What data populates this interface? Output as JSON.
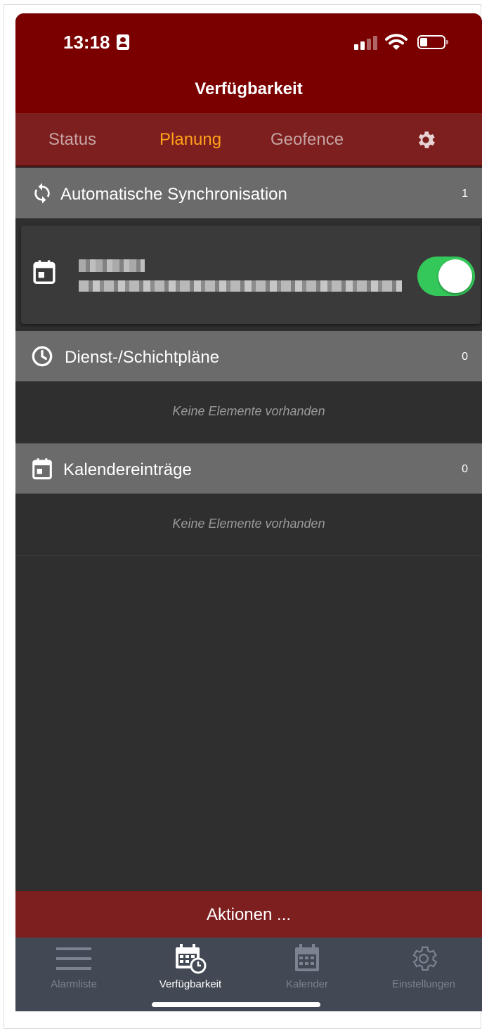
{
  "status_bar": {
    "time": "13:18"
  },
  "header": {
    "title": "Verfügbarkeit"
  },
  "tabs": [
    {
      "label": "Status",
      "active": false
    },
    {
      "label": "Planung",
      "active": true
    },
    {
      "label": "Geofence",
      "active": false
    }
  ],
  "sections": {
    "sync": {
      "title": "Automatische Synchronisation",
      "count": "1",
      "item": {
        "enabled": true
      }
    },
    "shifts": {
      "title": "Dienst-/Schichtpläne",
      "count": "0",
      "empty_text": "Keine Elemente vorhanden"
    },
    "calendar": {
      "title": "Kalendereinträge",
      "count": "0",
      "empty_text": "Keine Elemente vorhanden"
    }
  },
  "actions": {
    "label": "Aktionen ..."
  },
  "bottom_nav": [
    {
      "label": "Alarmliste",
      "icon": "menu-icon",
      "active": false
    },
    {
      "label": "Verfügbarkeit",
      "icon": "calendar-clock-icon",
      "active": true
    },
    {
      "label": "Kalender",
      "icon": "calendar-icon",
      "active": false
    },
    {
      "label": "Einstellungen",
      "icon": "gear-icon",
      "active": false
    }
  ],
  "colors": {
    "header_bg": "#7a0000",
    "tabs_bg": "#7e1f1f",
    "active_tab": "#ffa11a",
    "toggle_on": "#34c759",
    "nav_bg": "#424954"
  }
}
